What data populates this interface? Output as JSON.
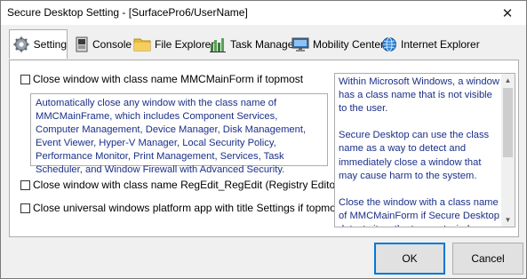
{
  "window": {
    "title": "Secure Desktop Setting - [SurfacePro6/UserName]",
    "close_glyph": "✕"
  },
  "tabs": [
    {
      "label": "Setting",
      "icon": "gear-icon",
      "active": true
    },
    {
      "label": "Console",
      "icon": "console-icon"
    },
    {
      "label": "File Explorer",
      "icon": "folder-icon"
    },
    {
      "label": "Task Manager",
      "icon": "bar-chart-icon"
    },
    {
      "label": "Mobility Center",
      "icon": "monitor-icon"
    },
    {
      "label": "Internet Explorer",
      "icon": "globe-icon"
    }
  ],
  "options": [
    {
      "label": "Close window with class name MMCMainForm if topmost",
      "checked": false
    },
    {
      "label": "Close window with class name RegEdit_RegEdit (Registry Editor) if topmost",
      "checked": false
    },
    {
      "label": "Close universal windows platform app with title Settings if topmost window",
      "checked": false
    }
  ],
  "description": "Automatically close any window with the class name of MMCMainFrame, which includes Component Services, Computer Management, Device Manager, Disk Management, Event Viewer, Hyper-V Manager, Local Security Policy, Performance Monitor, Print Management, Services, Task Scheduler, and Window Firewall with Advanced Security.",
  "info": {
    "paragraphs": [
      "Within Microsoft Windows, a window has a class name that is not visible to the user.",
      "Secure Desktop can use the class name as a way to detect and immediately close a window that may cause harm to the system.",
      "Close the window with a class name of MMCMainForm if Secure Desktop detects it as the topmost window."
    ]
  },
  "buttons": {
    "ok": "OK",
    "cancel": "Cancel"
  },
  "colors": {
    "accent": "#0078d7",
    "info_text": "#1b2f88"
  }
}
